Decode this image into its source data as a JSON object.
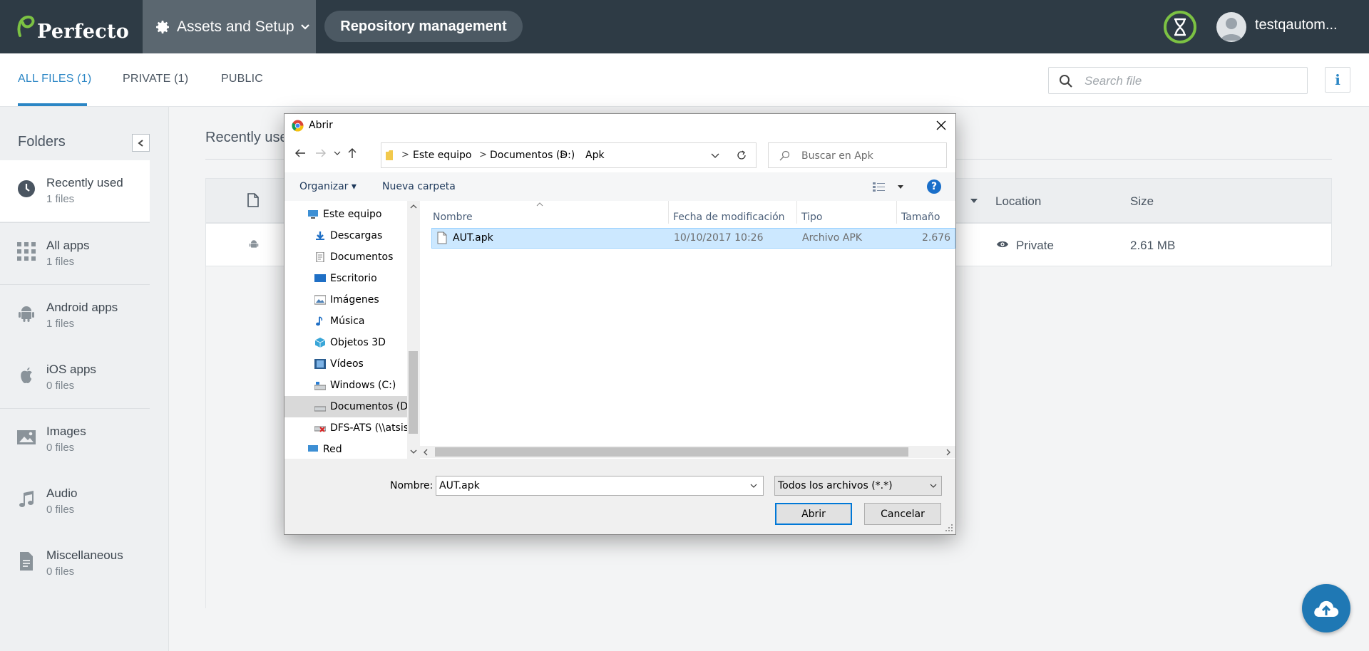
{
  "brand": {
    "name": "Perfecto"
  },
  "topbar": {
    "assets_label": "Assets and Setup",
    "repo_label": "Repository management",
    "user_name": "testqautom..."
  },
  "tabs": [
    {
      "label": "ALL FILES (1)",
      "active": true
    },
    {
      "label": "PRIVATE (1)",
      "active": false
    },
    {
      "label": "PUBLIC",
      "active": false
    }
  ],
  "search": {
    "placeholder": "Search file"
  },
  "sidebar": {
    "title": "Folders",
    "items": [
      {
        "label": "Recently used",
        "count": "1 files",
        "icon": "clock-icon",
        "active": true
      },
      {
        "label": "All apps",
        "count": "1 files",
        "icon": "grid-icon"
      },
      {
        "label": "Android apps",
        "count": "1 files",
        "icon": "android-icon"
      },
      {
        "label": "iOS apps",
        "count": "0 files",
        "icon": "apple-icon"
      },
      {
        "label": "Images",
        "count": "0 files",
        "icon": "image-icon"
      },
      {
        "label": "Audio",
        "count": "0 files",
        "icon": "music-icon"
      },
      {
        "label": "Miscellaneous",
        "count": "0 files",
        "icon": "document-icon"
      }
    ]
  },
  "main": {
    "title": "Recently use",
    "columns": {
      "location": "Location",
      "size": "Size"
    },
    "row": {
      "location": "Private",
      "size": "2.61 MB"
    }
  },
  "dialog": {
    "title": "Abrir",
    "breadcrumb": [
      "Este equipo",
      "Documentos (D:)",
      "Apk"
    ],
    "search_placeholder": "Buscar en Apk",
    "toolbar": {
      "organize": "Organizar",
      "new_folder": "Nueva carpeta"
    },
    "tree": [
      {
        "label": "Este equipo",
        "icon": "computer-icon",
        "indent": 0
      },
      {
        "label": "Descargas",
        "icon": "download-icon",
        "indent": 1
      },
      {
        "label": "Documentos",
        "icon": "documents-icon",
        "indent": 1
      },
      {
        "label": "Escritorio",
        "icon": "desktop-icon",
        "indent": 1
      },
      {
        "label": "Imágenes",
        "icon": "pictures-icon",
        "indent": 1
      },
      {
        "label": "Música",
        "icon": "music-note-icon",
        "indent": 1
      },
      {
        "label": "Objetos 3D",
        "icon": "cube-icon",
        "indent": 1
      },
      {
        "label": "Vídeos",
        "icon": "video-icon",
        "indent": 1
      },
      {
        "label": "Windows (C:)",
        "icon": "drive-icon",
        "indent": 1
      },
      {
        "label": "Documentos (D:)",
        "icon": "drive-icon",
        "indent": 1,
        "selected": true
      },
      {
        "label": "DFS-ATS (\\\\atsist",
        "icon": "network-drive-icon",
        "indent": 1
      },
      {
        "label": "Red",
        "icon": "network-icon",
        "indent": 0
      }
    ],
    "columns": {
      "name": "Nombre",
      "modified": "Fecha de modificación",
      "type": "Tipo",
      "size": "Tamaño"
    },
    "files": [
      {
        "name": "AUT.apk",
        "modified": "10/10/2017 10:26",
        "type": "Archivo APK",
        "size": "2.676"
      }
    ],
    "filename_label": "Nombre:",
    "filename_value": "AUT.apk",
    "filetype": "Todos los archivos (*.*)",
    "open_button": "Abrir",
    "cancel_button": "Cancelar"
  },
  "colors": {
    "topbar": "#2e3b45",
    "accent": "#2b86c5",
    "logo_green": "#7cc243",
    "fab": "#1f78b4"
  }
}
